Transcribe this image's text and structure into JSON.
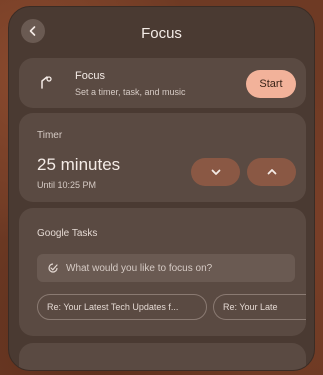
{
  "header": {
    "title": "Focus"
  },
  "focus": {
    "title": "Focus",
    "subtitle": "Set a timer, task, and music",
    "start_label": "Start"
  },
  "timer": {
    "label": "Timer",
    "value": "25 minutes",
    "until": "Until 10:25 PM"
  },
  "tasks": {
    "label": "Google Tasks",
    "placeholder": "What would you like to focus on?",
    "chips": [
      "Re: Your Latest Tech Updates f...",
      "Re: Your Late"
    ]
  },
  "colors": {
    "panel": "#4a3a32",
    "card": "#5a4a42",
    "accent": "#f2b29a",
    "stepper": "#8a5844"
  },
  "icons": {
    "back": "back-arrow-icon",
    "focus": "focus-lamp-icon",
    "down": "chevron-down-icon",
    "up": "chevron-up-icon",
    "task": "task-check-icon"
  }
}
